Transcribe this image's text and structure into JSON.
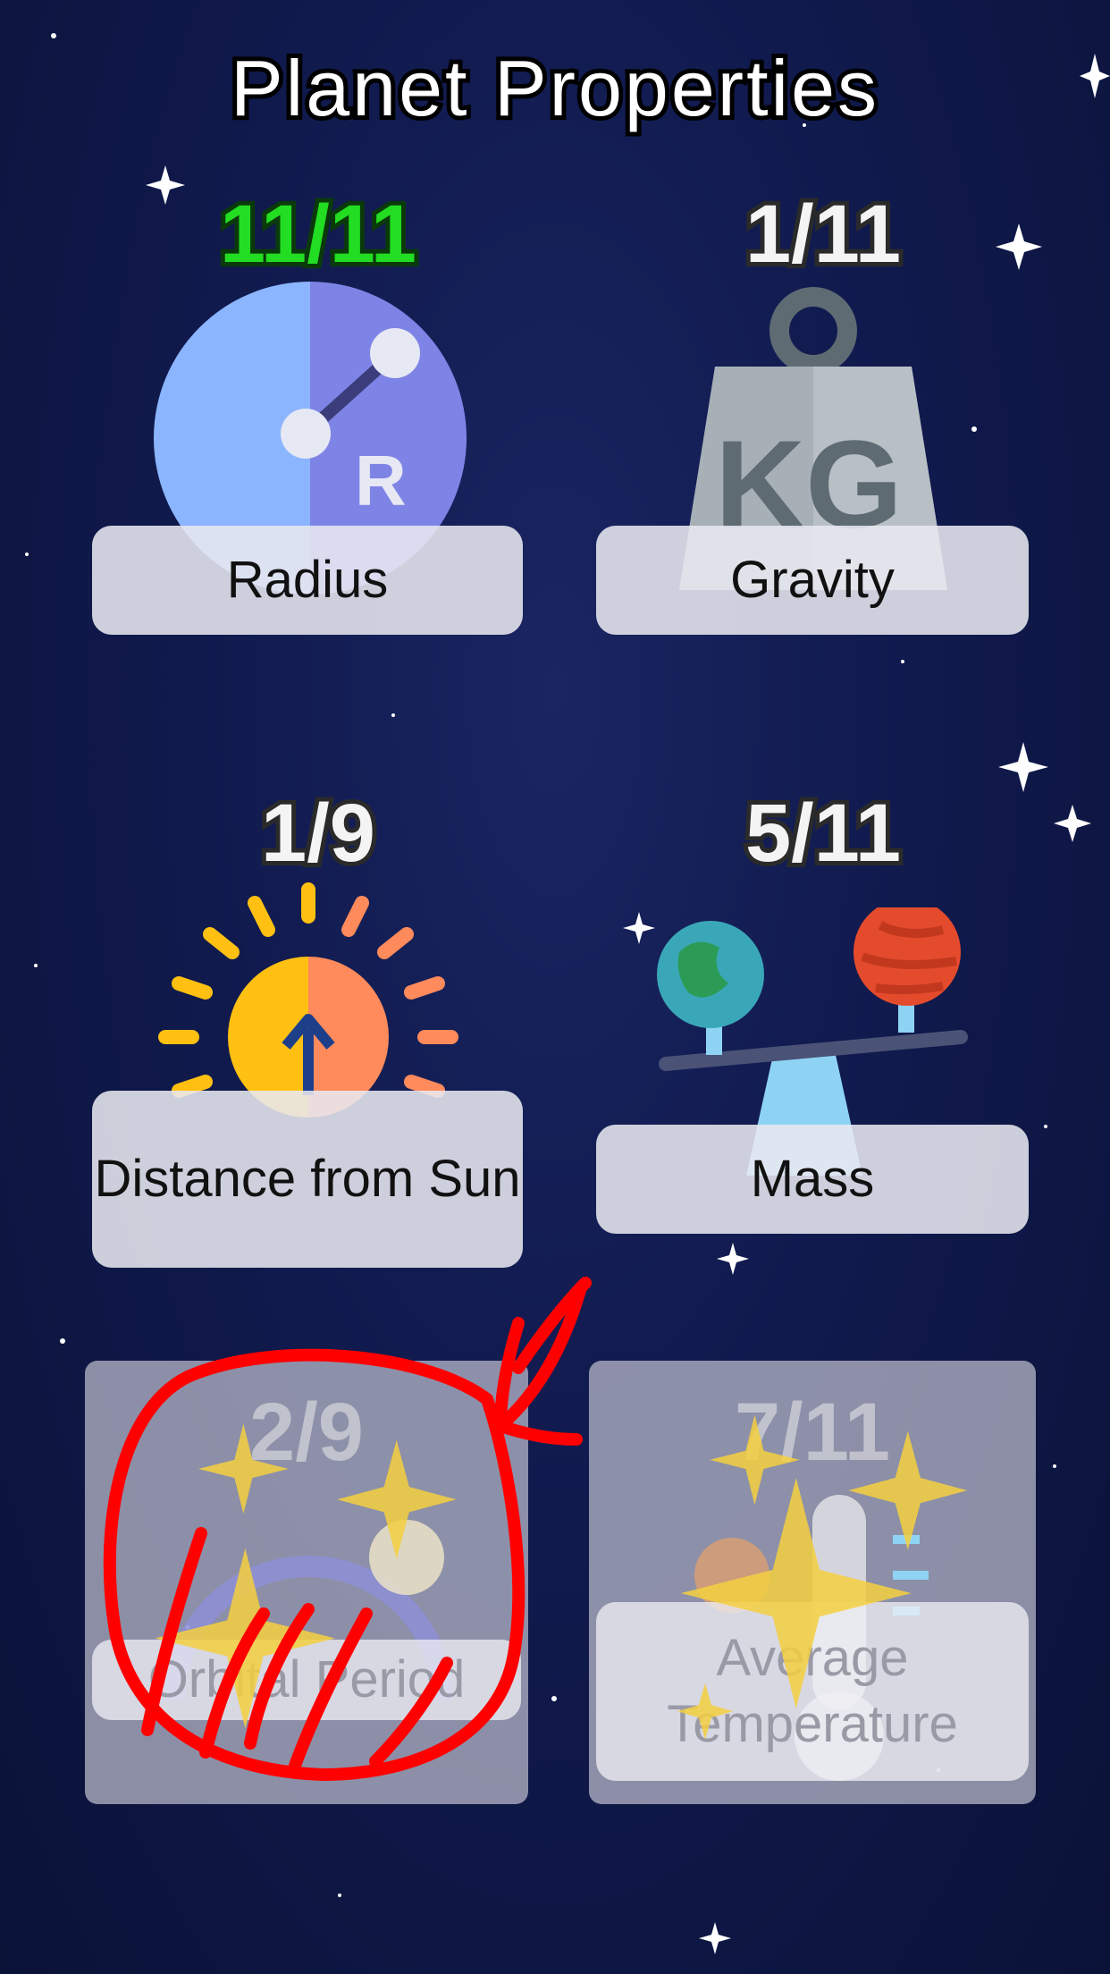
{
  "screen": {
    "title": "Planet Properties"
  },
  "properties": [
    {
      "id": "radius",
      "label": "Radius",
      "progress": "11/11",
      "complete": true,
      "locked": false,
      "icon": "ruler-circle-icon"
    },
    {
      "id": "gravity",
      "label": "Gravity",
      "progress": "1/11",
      "complete": false,
      "locked": false,
      "icon": "kg-weight-icon"
    },
    {
      "id": "distance",
      "label": "Distance from Sun",
      "progress": "1/9",
      "complete": false,
      "locked": false,
      "icon": "sun-icon"
    },
    {
      "id": "mass",
      "label": "Mass",
      "progress": "5/11",
      "complete": false,
      "locked": false,
      "icon": "planet-scale-icon"
    },
    {
      "id": "orbital",
      "label": "Orbital Period",
      "progress": "2/9",
      "complete": false,
      "locked": true,
      "icon": "orbit-icon"
    },
    {
      "id": "temperature",
      "label": "Average Temperature",
      "progress": "7/11",
      "complete": false,
      "locked": true,
      "icon": "thermometer-icon"
    }
  ],
  "colors": {
    "background": "#101a4d",
    "complete_progress": "#22dd22",
    "annotation": "#ff0000",
    "sparkle": "#f5d040"
  },
  "overlay": {
    "annotation": "red hand-drawn circle with arrow around Orbital Period card"
  }
}
